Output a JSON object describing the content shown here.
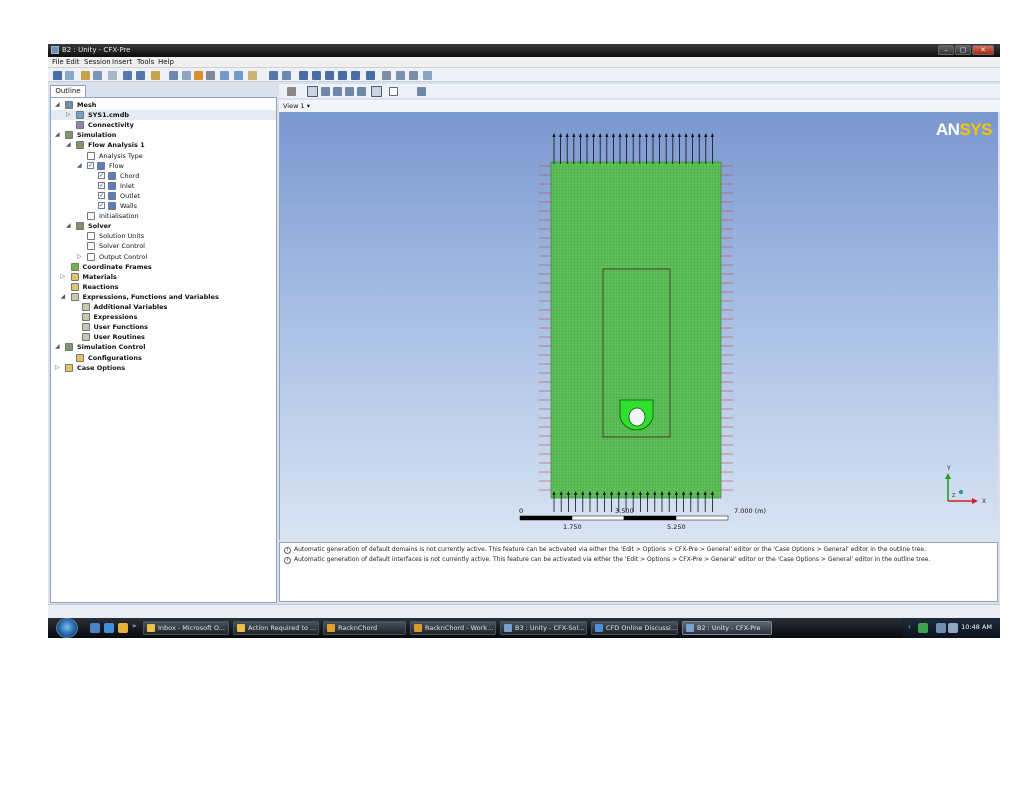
{
  "window": {
    "title": "B2 : Unity - CFX-Pre",
    "controls": [
      "–",
      "▢",
      "✕"
    ]
  },
  "menu": [
    "File",
    "Edit",
    "Session",
    "Insert",
    "Tools",
    "Help"
  ],
  "outline": {
    "tab_label": "Outline",
    "tree": [
      {
        "label": "Mesh",
        "bold": true,
        "level": 0,
        "exp": "◢",
        "icon": "mesh-icon",
        "color": "#6b8fb5"
      },
      {
        "label": "SYS1.cmdb",
        "bold": true,
        "level": 1,
        "exp": "▷",
        "icon": "mesh-file-icon",
        "color": "#7aa0c8",
        "selected": true
      },
      {
        "label": "Connectivity",
        "bold": true,
        "level": 1,
        "exp": "",
        "icon": "connectivity-icon",
        "color": "#8a8aa8"
      },
      {
        "label": "Simulation",
        "bold": true,
        "level": 0,
        "exp": "◢",
        "icon": "simulation-icon",
        "color": "#7a9a6a"
      },
      {
        "label": "Flow Analysis 1",
        "bold": true,
        "level": 1,
        "exp": "◢",
        "icon": "flow-analysis-icon",
        "color": "#7a9a6a"
      },
      {
        "label": "Analysis Type",
        "bold": false,
        "level": 2,
        "exp": "",
        "icon": "clock-icon",
        "color": "#ffffff"
      },
      {
        "label": "Flow",
        "bold": false,
        "level": 2,
        "exp": "◢",
        "icon": "domain-icon",
        "color": "#5b7fc4",
        "check": true
      },
      {
        "label": "Chord",
        "bold": false,
        "level": 3,
        "exp": "",
        "icon": "boundary-icon",
        "color": "#5b7fc4",
        "check": true
      },
      {
        "label": "Inlet",
        "bold": false,
        "level": 3,
        "exp": "",
        "icon": "boundary-icon",
        "color": "#5b7fc4",
        "check": true
      },
      {
        "label": "Outlet",
        "bold": false,
        "level": 3,
        "exp": "",
        "icon": "boundary-icon",
        "color": "#5b7fc4",
        "check": true
      },
      {
        "label": "Walls",
        "bold": false,
        "level": 3,
        "exp": "",
        "icon": "boundary-icon",
        "color": "#5b7fc4",
        "check": true
      },
      {
        "label": "Initialisation",
        "bold": false,
        "level": 2,
        "exp": "",
        "icon": "initialisation-icon",
        "color": "#ffffff"
      },
      {
        "label": "Solver",
        "bold": true,
        "level": 1,
        "exp": "◢",
        "icon": "solver-icon",
        "color": "#7a9a6a"
      },
      {
        "label": "Solution Units",
        "bold": false,
        "level": 2,
        "exp": "",
        "icon": "units-icon",
        "color": "#ffffff"
      },
      {
        "label": "Solver Control",
        "bold": false,
        "level": 2,
        "exp": "",
        "icon": "solver-control-icon",
        "color": "#ffffff"
      },
      {
        "label": "Output Control",
        "bold": false,
        "level": 2,
        "exp": "▷",
        "icon": "output-control-icon",
        "color": "#ffffff"
      },
      {
        "label": "Coordinate Frames",
        "bold": true,
        "level": 0.5,
        "exp": "",
        "icon": "coordinate-frames-icon",
        "color": "#6fb24f"
      },
      {
        "label": "Materials",
        "bold": true,
        "level": 0.5,
        "exp": "▷",
        "icon": "materials-icon",
        "color": "#e2c26b"
      },
      {
        "label": "Reactions",
        "bold": true,
        "level": 0.5,
        "exp": "",
        "icon": "reactions-icon",
        "color": "#e2c26b"
      },
      {
        "label": "Expressions, Functions and Variables",
        "bold": true,
        "level": 0.5,
        "exp": "◢",
        "icon": "expressions-icon",
        "color": "#c8c8b0"
      },
      {
        "label": "Additional Variables",
        "bold": true,
        "level": 1.5,
        "exp": "",
        "icon": "variables-icon",
        "color": "#c8c8b0"
      },
      {
        "label": "Expressions",
        "bold": true,
        "level": 1.5,
        "exp": "",
        "icon": "expression-icon",
        "color": "#c8c8b0"
      },
      {
        "label": "User Functions",
        "bold": true,
        "level": 1.5,
        "exp": "",
        "icon": "user-functions-icon",
        "color": "#c8c8b0"
      },
      {
        "label": "User Routines",
        "bold": true,
        "level": 1.5,
        "exp": "",
        "icon": "user-routines-icon",
        "color": "#c8c8b0"
      },
      {
        "label": "Simulation Control",
        "bold": true,
        "level": 0,
        "exp": "◢",
        "icon": "simulation-control-icon",
        "color": "#7a9a6a"
      },
      {
        "label": "Configurations",
        "bold": true,
        "level": 1,
        "exp": "",
        "icon": "configurations-icon",
        "color": "#e2c26b"
      },
      {
        "label": "Case Options",
        "bold": true,
        "level": 0,
        "exp": "▷",
        "icon": "case-options-icon",
        "color": "#e2c26b"
      }
    ]
  },
  "viewer": {
    "view_label": "View 1 ▾",
    "logo_an": "AN",
    "logo_sys": "SYS",
    "scale": {
      "labels_top": [
        "0",
        "3.500",
        "7.000 (m)"
      ],
      "labels_bottom": [
        "1.750",
        "5.250"
      ]
    },
    "axis_labels": {
      "y": "Y",
      "x": "X",
      "z": "Z"
    }
  },
  "messages": [
    "Automatic generation of default domains is not currently active. This feature can be activated via either the 'Edit > Options > CFX-Pre > General' editor or the 'Case Options > General' editor in the outline tree.",
    "Automatic generation of default interfaces is not currently active. This feature can be activated via either the 'Edit > Options > CFX-Pre > General' editor or the 'Case Options > General' editor in the outline tree."
  ],
  "taskbar": {
    "items": [
      {
        "label": "Inbox - Microsoft O...",
        "color": "#e8c04a",
        "icon": "outlook-icon"
      },
      {
        "label": "Action Required to ...",
        "color": "#e8c04a",
        "icon": "mail-icon"
      },
      {
        "label": "RacknChord",
        "color": "#e0a030",
        "icon": "folder-icon"
      },
      {
        "label": "RacknChord - Work...",
        "color": "#d99a2b",
        "icon": "ansys-workbench-icon"
      },
      {
        "label": "B3 : Unity - CFX-Sol...",
        "color": "#7aa0d0",
        "icon": "cfx-solver-icon"
      },
      {
        "label": "CFD Online Discussi...",
        "color": "#4a90d9",
        "icon": "ie-icon"
      },
      {
        "label": "B2 : Unity - CFX-Pre",
        "color": "#7aa0d0",
        "icon": "cfx-pre-icon",
        "active": true
      }
    ],
    "clock": "10:48 AM"
  }
}
